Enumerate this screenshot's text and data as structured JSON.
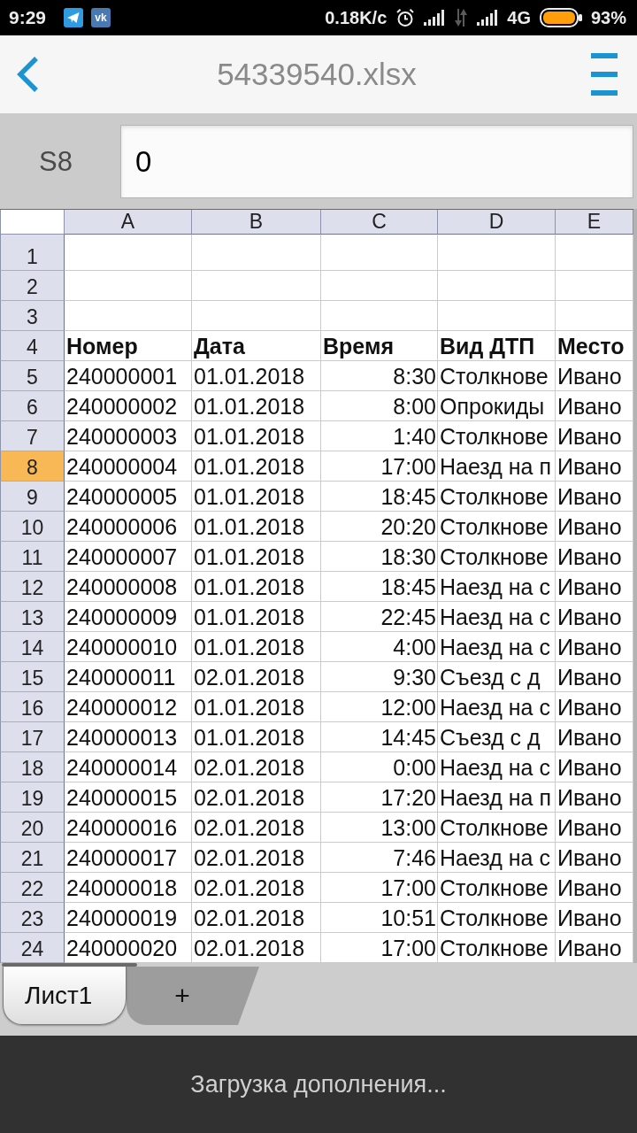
{
  "status_bar": {
    "time": "9:29",
    "notification_badge": "vk",
    "network_speed": "0.18K/c",
    "network_type": "4G",
    "battery": "93%"
  },
  "app_bar": {
    "title": "54339540.xlsx"
  },
  "formula_bar": {
    "cell_reference": "S8",
    "value": "0"
  },
  "sheet": {
    "columns": [
      {
        "letter": "A",
        "numeric": false
      },
      {
        "letter": "B",
        "numeric": false
      },
      {
        "letter": "C",
        "numeric": true
      },
      {
        "letter": "D",
        "numeric": false
      },
      {
        "letter": "E",
        "numeric": false
      }
    ],
    "rows": [
      {
        "number": "1",
        "selected": false,
        "kind": "record"
      },
      {
        "number": "2",
        "selected": false,
        "kind": "record"
      },
      {
        "number": "3",
        "selected": false,
        "kind": "record"
      },
      {
        "number": "4",
        "selected": false,
        "kind": "header",
        "cells": [
          "Номер",
          "Дата",
          "Время",
          "Вид ДТП",
          "Место"
        ]
      },
      {
        "number": "5",
        "selected": false,
        "kind": "record",
        "cells": [
          "240000001",
          "01.01.2018",
          "8:30",
          "Столкнове",
          "Ивано"
        ]
      },
      {
        "number": "6",
        "selected": false,
        "kind": "record",
        "cells": [
          "240000002",
          "01.01.2018",
          "8:00",
          "Опрокиды",
          "Ивано"
        ]
      },
      {
        "number": "7",
        "selected": false,
        "kind": "record",
        "cells": [
          "240000003",
          "01.01.2018",
          "1:40",
          "Столкнове",
          "Ивано"
        ]
      },
      {
        "number": "8",
        "selected": true,
        "kind": "record",
        "cells": [
          "240000004",
          "01.01.2018",
          "17:00",
          "Наезд на п",
          "Ивано"
        ]
      },
      {
        "number": "9",
        "selected": false,
        "kind": "record",
        "cells": [
          "240000005",
          "01.01.2018",
          "18:45",
          "Столкнове",
          "Ивано"
        ]
      },
      {
        "number": "10",
        "selected": false,
        "kind": "record",
        "cells": [
          "240000006",
          "01.01.2018",
          "20:20",
          "Столкнове",
          "Ивано"
        ]
      },
      {
        "number": "11",
        "selected": false,
        "kind": "record",
        "cells": [
          "240000007",
          "01.01.2018",
          "18:30",
          "Столкнове",
          "Ивано"
        ]
      },
      {
        "number": "12",
        "selected": false,
        "kind": "record",
        "cells": [
          "240000008",
          "01.01.2018",
          "18:45",
          "Наезд на с",
          "Ивано"
        ]
      },
      {
        "number": "13",
        "selected": false,
        "kind": "record",
        "cells": [
          "240000009",
          "01.01.2018",
          "22:45",
          "Наезд на с",
          "Ивано"
        ]
      },
      {
        "number": "14",
        "selected": false,
        "kind": "record",
        "cells": [
          "240000010",
          "01.01.2018",
          "4:00",
          "Наезд на с",
          "Ивано"
        ]
      },
      {
        "number": "15",
        "selected": false,
        "kind": "record",
        "cells": [
          "240000011",
          "02.01.2018",
          "9:30",
          "Съезд с д",
          "Ивано"
        ]
      },
      {
        "number": "16",
        "selected": false,
        "kind": "record",
        "cells": [
          "240000012",
          "01.01.2018",
          "12:00",
          "Наезд на с",
          "Ивано"
        ]
      },
      {
        "number": "17",
        "selected": false,
        "kind": "record",
        "cells": [
          "240000013",
          "01.01.2018",
          "14:45",
          "Съезд с д",
          "Ивано"
        ]
      },
      {
        "number": "18",
        "selected": false,
        "kind": "record",
        "cells": [
          "240000014",
          "02.01.2018",
          "0:00",
          "Наезд на с",
          "Ивано"
        ]
      },
      {
        "number": "19",
        "selected": false,
        "kind": "record",
        "cells": [
          "240000015",
          "02.01.2018",
          "17:20",
          "Наезд на п",
          "Ивано"
        ]
      },
      {
        "number": "20",
        "selected": false,
        "kind": "record",
        "cells": [
          "240000016",
          "02.01.2018",
          "13:00",
          "Столкнове",
          "Ивано"
        ]
      },
      {
        "number": "21",
        "selected": false,
        "kind": "record",
        "cells": [
          "240000017",
          "02.01.2018",
          "7:46",
          "Наезд на с",
          "Ивано"
        ]
      },
      {
        "number": "22",
        "selected": false,
        "kind": "record",
        "cells": [
          "240000018",
          "02.01.2018",
          "17:00",
          "Столкнове",
          "Ивано"
        ]
      },
      {
        "number": "23",
        "selected": false,
        "kind": "record",
        "cells": [
          "240000019",
          "02.01.2018",
          "10:51",
          "Столкнове",
          "Ивано"
        ]
      },
      {
        "number": "24",
        "selected": false,
        "kind": "record",
        "cells": [
          "240000020",
          "02.01.2018",
          "17:00",
          "Столкнове",
          "Ивано"
        ]
      }
    ]
  },
  "sheet_tabs": [
    {
      "label": "Лист1",
      "selected": true
    }
  ],
  "add_sheet_button": {
    "label": "+"
  },
  "status_message": "Загрузка дополнения..."
}
